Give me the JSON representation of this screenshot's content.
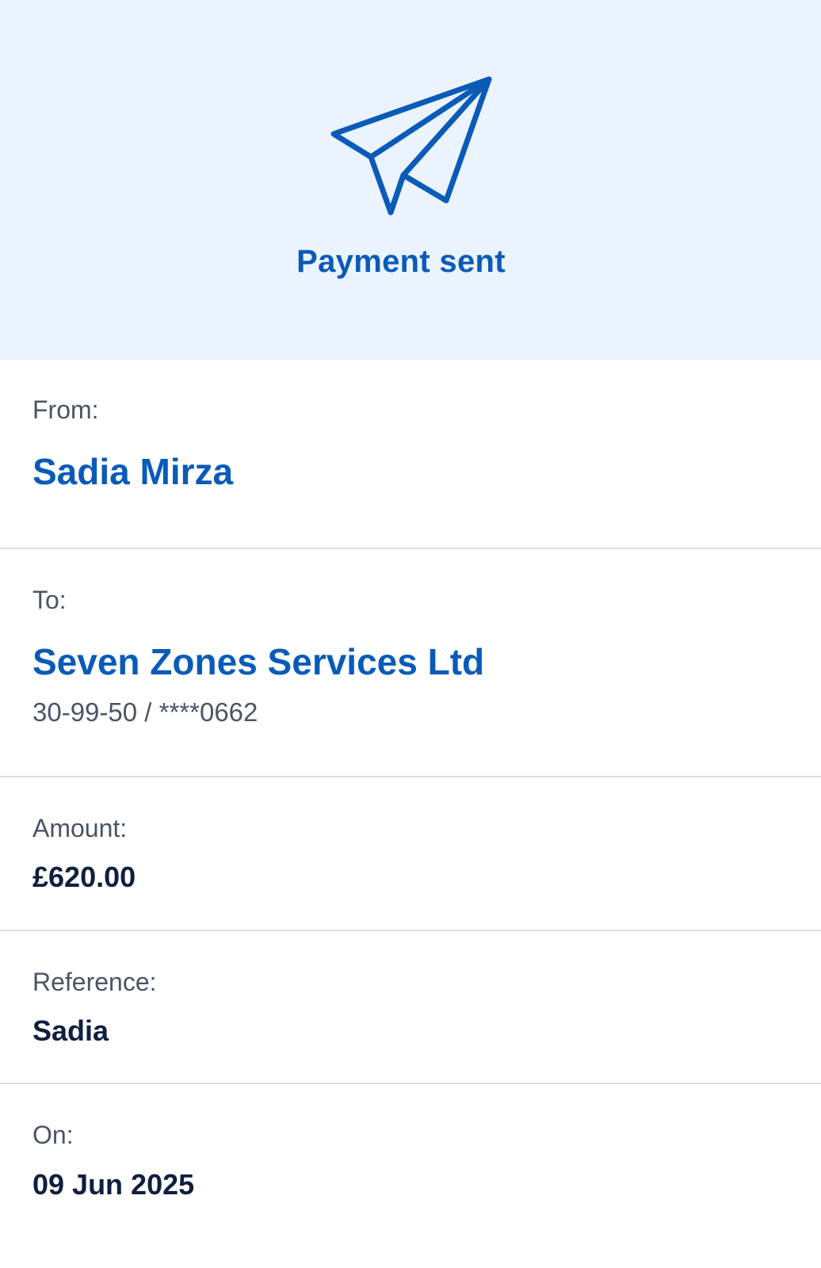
{
  "header": {
    "title": "Payment sent",
    "icon": "paper-plane-icon",
    "background_color": "#eaf3fe",
    "accent_color": "#0a5bb8"
  },
  "details": {
    "from": {
      "label": "From:",
      "name": "Sadia Mirza"
    },
    "to": {
      "label": "To:",
      "name": "Seven Zones Services Ltd",
      "account": "30-99-50 / ****0662"
    },
    "amount": {
      "label": "Amount:",
      "value": "£620.00"
    },
    "reference": {
      "label": "Reference:",
      "value": "Sadia"
    },
    "date": {
      "label": "On:",
      "value": "09 Jun 2025"
    }
  }
}
